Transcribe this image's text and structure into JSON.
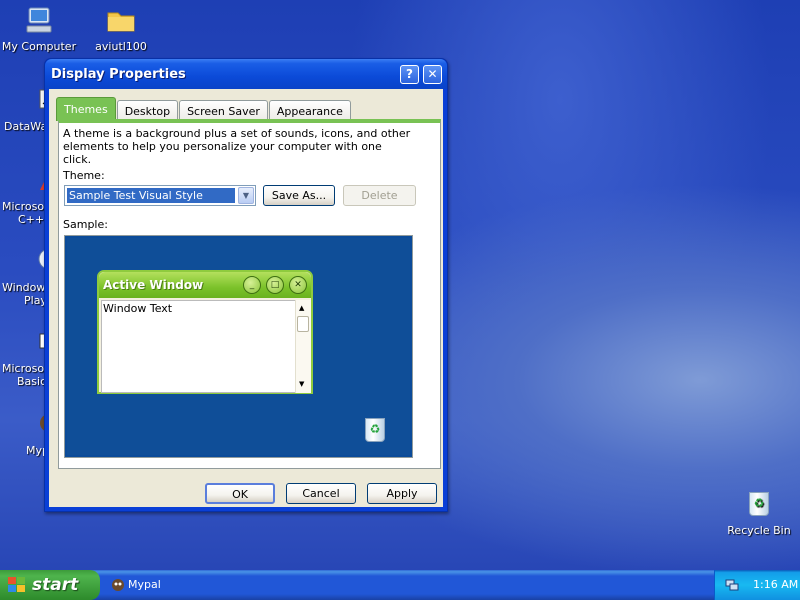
{
  "desktop": {
    "icons": [
      {
        "label": "My Computer"
      },
      {
        "label": "aviutl100"
      },
      {
        "label": "Recycle Bin"
      }
    ],
    "left_partial_icons": [
      {
        "label_line1": "DataWa",
        "label_line2": ""
      },
      {
        "label_line1": "Microsoft",
        "label_line2": "C++"
      },
      {
        "label_line1": "Windows",
        "label_line2": "Play"
      },
      {
        "label_line1": "Microsoft",
        "label_line2": "Basic"
      },
      {
        "label_line1": "Myp",
        "label_line2": ""
      }
    ]
  },
  "dialog": {
    "title": "Display Properties",
    "help_btn": "?",
    "close_btn": "✕",
    "tabs": [
      {
        "label": "Themes",
        "active": true
      },
      {
        "label": "Desktop",
        "active": false
      },
      {
        "label": "Screen Saver",
        "active": false
      },
      {
        "label": "Appearance",
        "active": false
      }
    ],
    "description": "A theme is a background plus a set of sounds, icons, and other elements to help you personalize your computer with one click.",
    "theme_label": "Theme:",
    "theme_value": "Sample Test Visual Style",
    "save_as": "Save As...",
    "delete": "Delete",
    "sample_label": "Sample:",
    "sample": {
      "window_title": "Active Window",
      "window_text": "Window Text",
      "min": "_",
      "max": "□",
      "close": "✕"
    },
    "ok": "OK",
    "cancel": "Cancel",
    "apply": "Apply"
  },
  "taskbar": {
    "start": "start",
    "task": "Mypal",
    "clock": "1:16 AM"
  }
}
